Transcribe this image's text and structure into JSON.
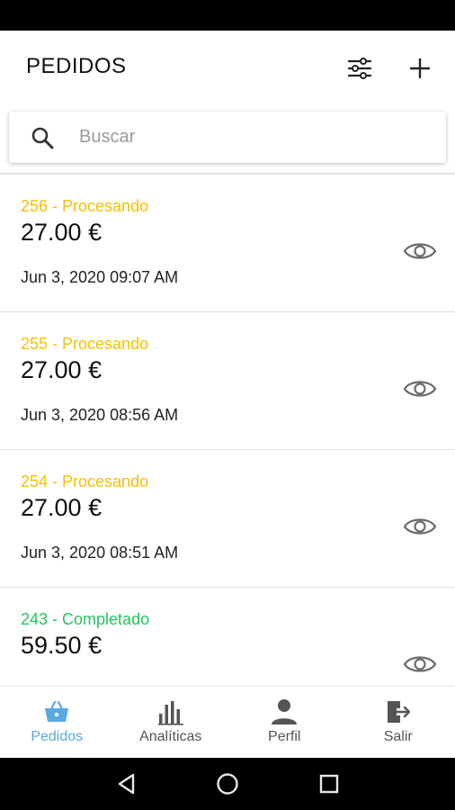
{
  "header": {
    "title": "PEDIDOS"
  },
  "search": {
    "placeholder": "Buscar",
    "value": ""
  },
  "orders": [
    {
      "status": "256 - Procesando",
      "status_color": "#f5c000",
      "amount": "27.00 €",
      "date": "Jun 3, 2020 09:07 AM"
    },
    {
      "status": "255 - Procesando",
      "status_color": "#f5c000",
      "amount": "27.00 €",
      "date": "Jun 3, 2020 08:56 AM"
    },
    {
      "status": "254 - Procesando",
      "status_color": "#f5c000",
      "amount": "27.00 €",
      "date": "Jun 3, 2020 08:51 AM"
    },
    {
      "status": "243 - Completado",
      "status_color": "#22c55e",
      "amount": "59.50 €",
      "date": ""
    }
  ],
  "bottom_nav": {
    "items": [
      {
        "label": "Pedidos",
        "icon": "shopping-basket-icon",
        "active": true
      },
      {
        "label": "Analíticas",
        "icon": "bar-chart-icon",
        "active": false
      },
      {
        "label": "Perfil",
        "icon": "person-icon",
        "active": false
      },
      {
        "label": "Salir",
        "icon": "logout-icon",
        "active": false
      }
    ]
  },
  "colors": {
    "processing": "#f5c000",
    "completed": "#22c55e",
    "accent": "#5aa8e0",
    "icon_gray": "#555555"
  }
}
